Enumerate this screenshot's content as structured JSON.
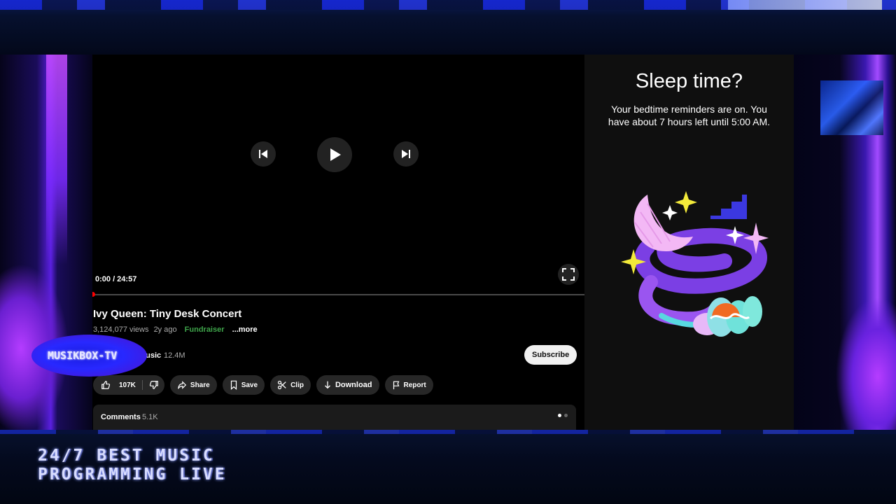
{
  "player": {
    "time": "0:00 / 24:57",
    "progress": 0
  },
  "video": {
    "title": "Ivy Queen: Tiny Desk Concert",
    "views": "3,124,077 views",
    "ago": "2y ago",
    "fundraiser": "Fundraiser",
    "more": "...more"
  },
  "channel": {
    "name": "Music",
    "subscribers": "12.4M",
    "subscribe_label": "Subscribe"
  },
  "actions": {
    "likes": "107K",
    "share": "Share",
    "save": "Save",
    "clip": "Clip",
    "download": "Download",
    "report": "Report"
  },
  "comments": {
    "label": "Comments",
    "count": "5.1K"
  },
  "sleep": {
    "title": "Sleep time?",
    "message": "Your bedtime reminders are on. You have about 7 hours left until 5:00 AM."
  },
  "overlay": {
    "logo": "MUSIKBOX-TV",
    "live_line1": "24/7 BEST MUSIC",
    "live_line2": "PROGRAMMING LIVE"
  },
  "colors": {
    "accent_red": "#ff0000",
    "fundraiser_green": "#3ea34a",
    "panel_bg": "#0f0f0f"
  }
}
